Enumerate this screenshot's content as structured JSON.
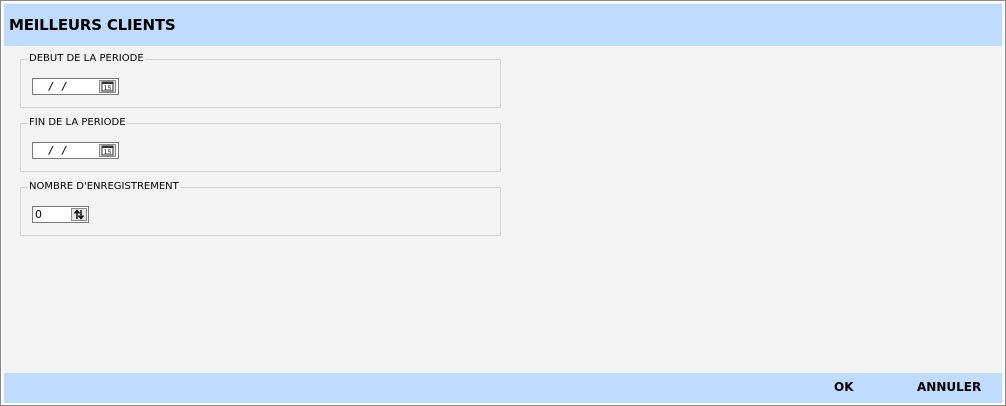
{
  "window": {
    "title": "MEILLEURS CLIENTS"
  },
  "form": {
    "start_period": {
      "label": "DEBUT DE LA PERIODE",
      "value": " / /",
      "calendar_icon": "calendar-icon"
    },
    "end_period": {
      "label": "FIN DE LA PERIODE",
      "value": " / /",
      "calendar_icon": "calendar-icon"
    },
    "record_count": {
      "label": "NOMBRE D'ENREGISTREMENT",
      "value": "0",
      "spinner_icon": "up-down-arrows-icon"
    }
  },
  "actions": {
    "ok_label": "OK",
    "cancel_label": "ANNULER"
  },
  "colors": {
    "title_bar": "#bfdbfd",
    "bottom_bar": "#bfdbfd",
    "background": "#f3f3f3"
  }
}
